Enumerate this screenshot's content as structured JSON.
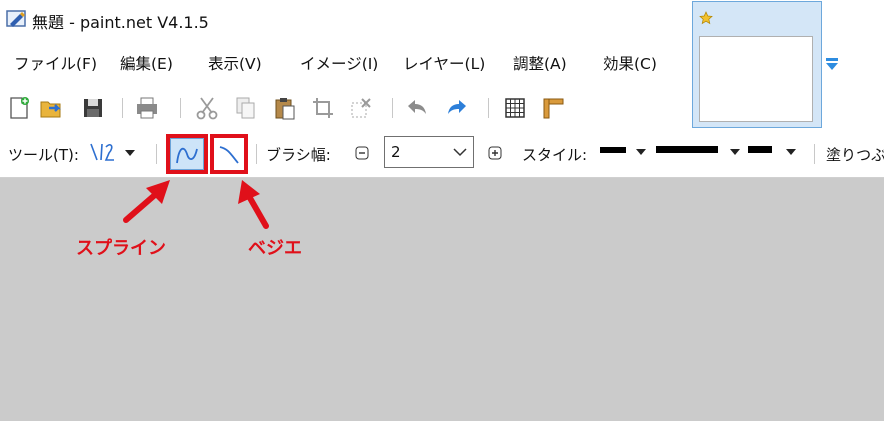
{
  "window": {
    "title": "無題 - paint.net V4.1.5"
  },
  "menu": {
    "items": [
      "ファイル(F)",
      "編集(E)",
      "表示(V)",
      "イメージ(I)",
      "レイヤー(L)",
      "調整(A)",
      "効果(C)"
    ]
  },
  "toolbar": {
    "icons": [
      "new-image-icon",
      "open-icon",
      "save-icon",
      "print-icon",
      "cut-icon",
      "copy-icon",
      "paste-icon",
      "crop-icon",
      "deselect-icon",
      "undo-icon",
      "redo-icon",
      "grid-icon",
      "ruler-icon"
    ]
  },
  "tools_bar": {
    "tool_label": "ツール(T):",
    "brush_width_label": "ブラシ幅:",
    "brush_width_value": "2",
    "style_label": "スタイル:",
    "fill_label": "塗りつぶ"
  },
  "annotations": {
    "spline": "スプライン",
    "bezier": "ベジエ"
  },
  "colors": {
    "accent_red": "#e0101a",
    "canvas_bg": "#cbcbcb",
    "popup_bg": "#d4e6f7"
  }
}
